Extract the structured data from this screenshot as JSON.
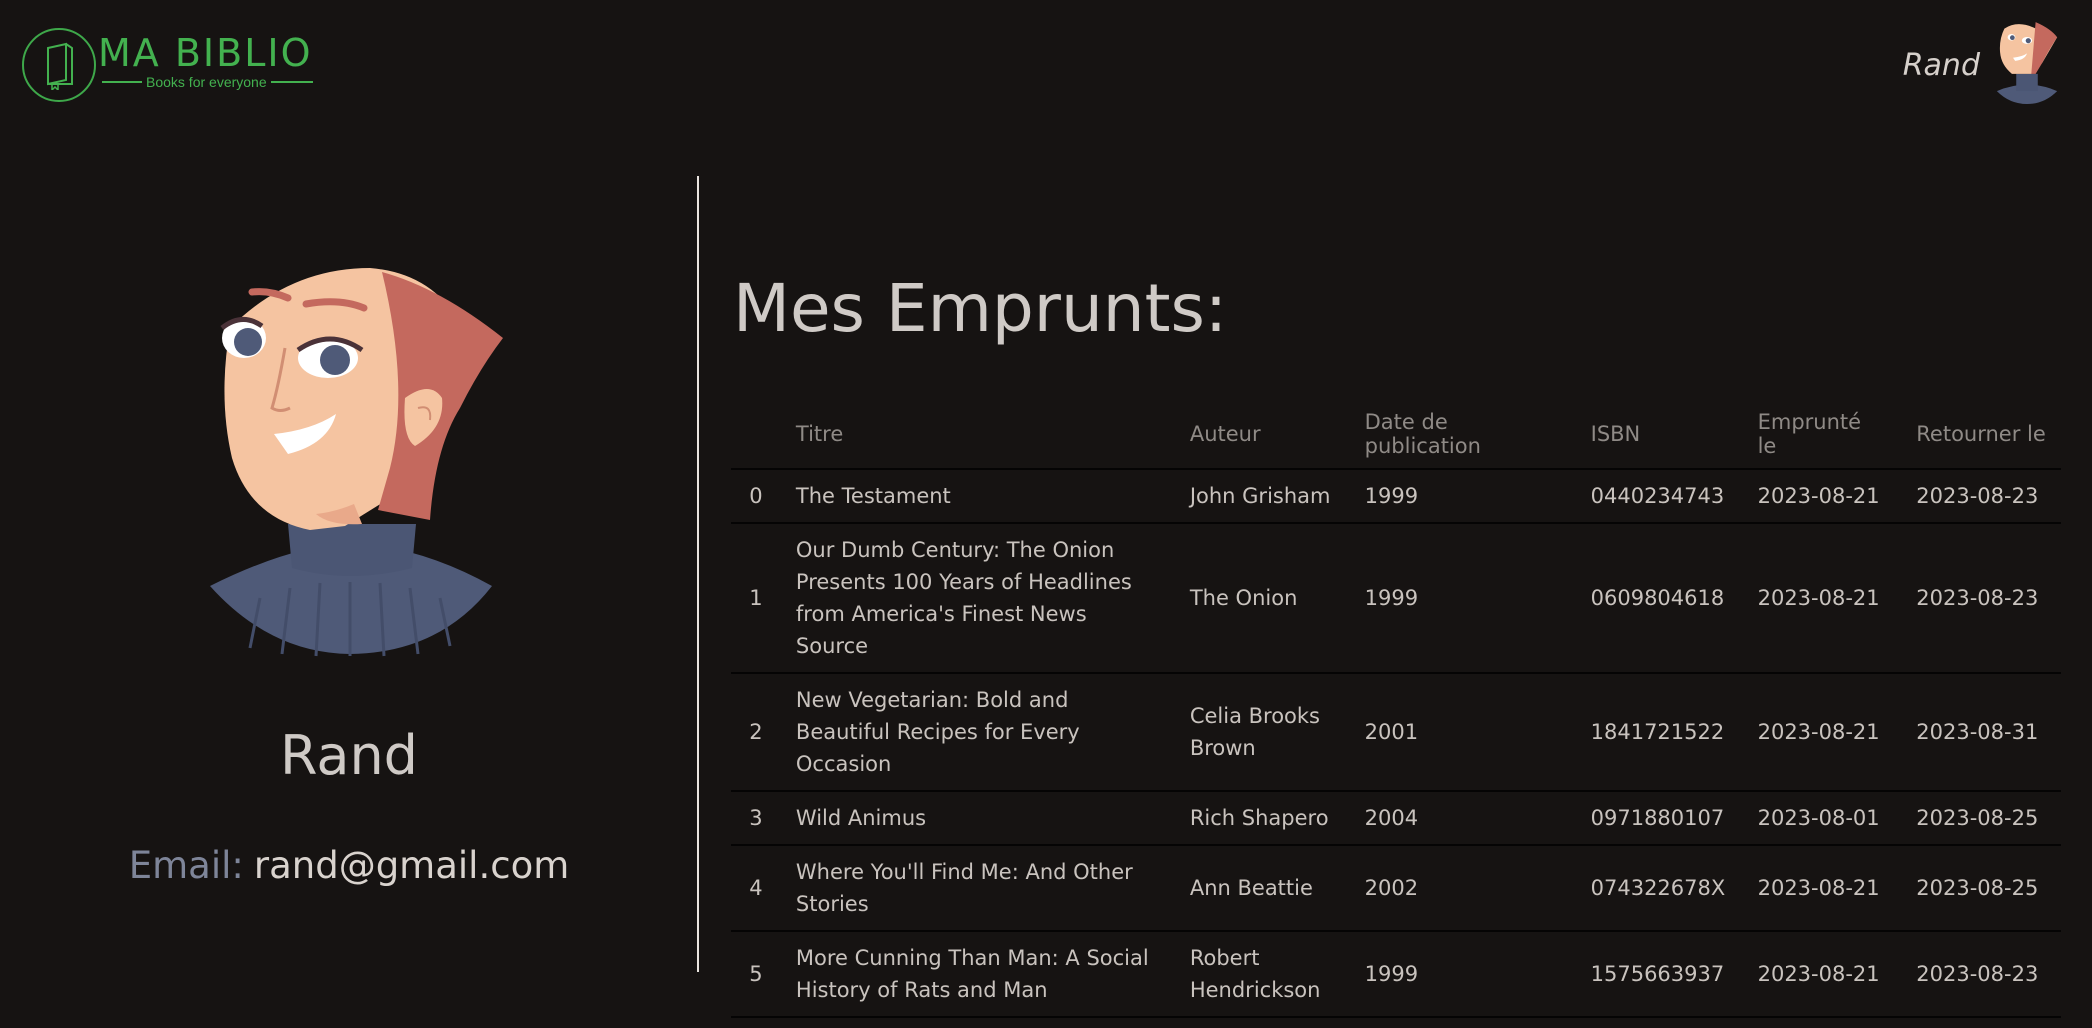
{
  "header": {
    "logo_title": "MA BIBLIO",
    "logo_subtitle": "Books for everyone",
    "user_name": "Rand"
  },
  "profile": {
    "name": "Rand",
    "email_label": "Email:",
    "email": "rand@gmail.com"
  },
  "loans": {
    "title": "Mes Emprunts:",
    "columns": [
      "",
      "Titre",
      "Auteur",
      "Date de publication",
      "ISBN",
      "Emprunté le",
      "Retourner le"
    ],
    "rows": [
      {
        "idx": "0",
        "title": "The Testament",
        "author": "John Grisham",
        "year": "1999",
        "isbn": "0440234743",
        "borrowed": "2023-08-21",
        "return": "2023-08-23"
      },
      {
        "idx": "1",
        "title": "Our Dumb Century: The Onion Presents 100 Years of Headlines from America's Finest News Source",
        "author": "The Onion",
        "year": "1999",
        "isbn": "0609804618",
        "borrowed": "2023-08-21",
        "return": "2023-08-23"
      },
      {
        "idx": "2",
        "title": "New Vegetarian: Bold and Beautiful Recipes for Every Occasion",
        "author": "Celia Brooks Brown",
        "year": "2001",
        "isbn": "1841721522",
        "borrowed": "2023-08-21",
        "return": "2023-08-31"
      },
      {
        "idx": "3",
        "title": "Wild Animus",
        "author": "Rich Shapero",
        "year": "2004",
        "isbn": "0971880107",
        "borrowed": "2023-08-01",
        "return": "2023-08-25"
      },
      {
        "idx": "4",
        "title": "Where You'll Find Me: And Other Stories",
        "author": "Ann Beattie",
        "year": "2002",
        "isbn": "074322678X",
        "borrowed": "2023-08-21",
        "return": "2023-08-25"
      },
      {
        "idx": "5",
        "title": "More Cunning Than Man: A Social History of Rats and Man",
        "author": "Robert Hendrickson",
        "year": "1999",
        "isbn": "1575663937",
        "borrowed": "2023-08-21",
        "return": "2023-08-23"
      }
    ]
  },
  "colors": {
    "background": "#161312",
    "brand_green": "#43b14f",
    "text": "#cfcac6",
    "email_label": "#7e8599"
  },
  "icons": {
    "logo": "book-icon",
    "avatar": "user-avatar"
  }
}
